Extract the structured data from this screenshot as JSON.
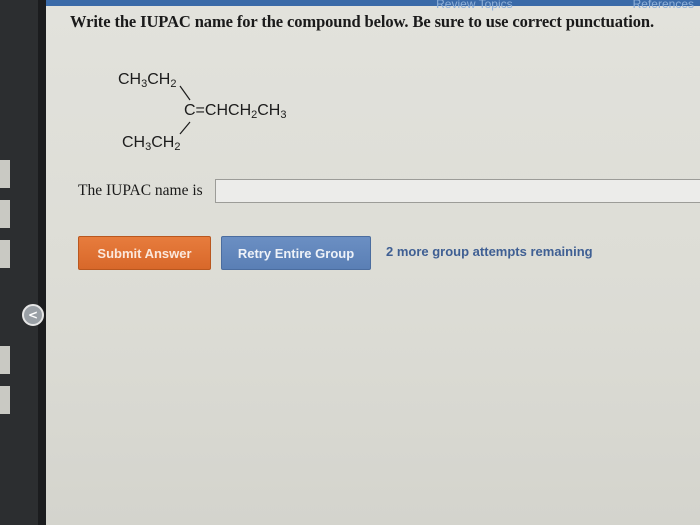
{
  "header": {
    "links": [
      "Review Topics",
      "References"
    ]
  },
  "question": {
    "prompt": "Write the IUPAC name for the compound below. Be sure to use correct punctuation."
  },
  "structure": {
    "top_group": {
      "main": "CH",
      "sub1": "3",
      "mid": "CH",
      "sub2": "2"
    },
    "bottom_group": {
      "main": "CH",
      "sub1": "3",
      "mid": "CH",
      "sub2": "2"
    },
    "center": {
      "pre": "C=CHCH",
      "sub1": "2",
      "mid": "CH",
      "sub2": "3"
    }
  },
  "answer": {
    "label": "The IUPAC name is",
    "value": "",
    "placeholder": ""
  },
  "actions": {
    "submit_label": "Submit Answer",
    "retry_label": "Retry Entire Group",
    "attempts_text": "2 more group attempts remaining"
  },
  "colors": {
    "submit": "#d8682a",
    "retry": "#5a7fb5",
    "attempts_text": "#3f5f93",
    "top_bar": "#3a6aa8"
  },
  "icons": {
    "collapse": "chevron-left-icon"
  }
}
